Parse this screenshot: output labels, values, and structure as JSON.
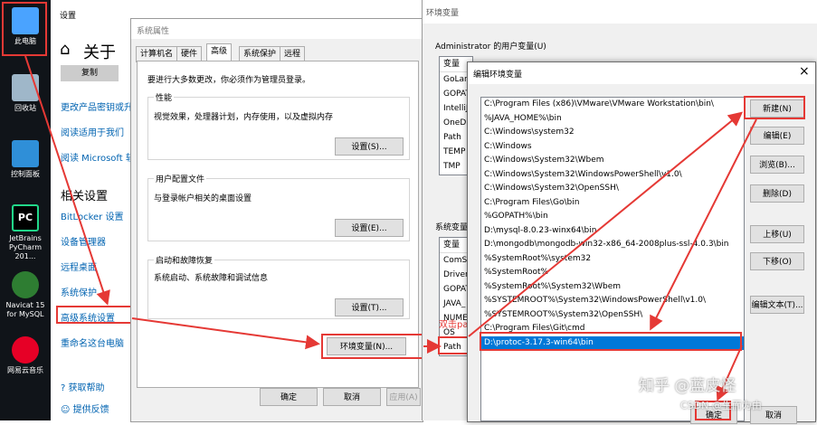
{
  "desktop": {
    "icons": [
      {
        "label": "此电脑",
        "icon": "this-pc-icon",
        "color": "#4aa3ff"
      },
      {
        "label": "回收站",
        "icon": "recycle-bin-icon",
        "color": "#9fb7c9"
      },
      {
        "label": "控制面板",
        "icon": "control-panel-icon",
        "color": "#2f8fd8"
      },
      {
        "label": "JetBrains PyCharm 201...",
        "icon": "pycharm-icon",
        "color": "#21d789"
      },
      {
        "label": "Navicat 15 for MySQL",
        "icon": "navicat-icon",
        "color": "#2e7d32"
      },
      {
        "label": "网易云音乐",
        "icon": "netease-music-icon",
        "color": "#e60026"
      }
    ]
  },
  "settings": {
    "title": "设置",
    "heading": "关于",
    "copy_button": "复制",
    "links_top": [
      "更改产品密钥或升",
      "阅读适用于我们",
      "阅读 Microsoft 软"
    ],
    "related_heading": "相关设置",
    "related_links": [
      "BitLocker 设置",
      "设备管理器",
      "远程桌面",
      "系统保护",
      "高级系统设置",
      "重命名这台电脑"
    ],
    "help": "获取帮助",
    "feedback": "提供反馈"
  },
  "sysprops": {
    "title": "系统属性",
    "tabs": [
      "计算机名",
      "硬件",
      "高级",
      "系统保护",
      "远程"
    ],
    "admin_note": "要进行大多数更改，你必须作为管理员登录。",
    "performance": {
      "title": "性能",
      "desc": "视觉效果，处理器计划，内存使用，以及虚拟内存",
      "button": "设置(S)..."
    },
    "profile": {
      "title": "用户配置文件",
      "desc": "与登录帐户相关的桌面设置",
      "button": "设置(E)..."
    },
    "startup": {
      "title": "启动和故障恢复",
      "desc": "系统启动、系统故障和调试信息",
      "button": "设置(T)..."
    },
    "env_button": "环境变量(N)...",
    "ok": "确定",
    "cancel": "取消",
    "apply": "应用(A)"
  },
  "envvars": {
    "title": "环境变量",
    "user_section": "Administrator 的用户变量(U)",
    "col_var": "变量",
    "user_vars": [
      "GoLan",
      "GOPAT",
      "IntelliJ",
      "OneDr",
      "Path",
      "TEMP",
      "TMP"
    ],
    "system_section": "系统变量",
    "system_vars": [
      "ComSp",
      "Driver",
      "GOPAT",
      "JAVA_",
      "NUME",
      "OS",
      "Path"
    ],
    "annotation": "双击path"
  },
  "editenv": {
    "title": "编辑环境变量",
    "close": "×",
    "paths": [
      "C:\\Program Files (x86)\\VMware\\VMware Workstation\\bin\\",
      "%JAVA_HOME%\\bin",
      "C:\\Windows\\system32",
      "C:\\Windows",
      "C:\\Windows\\System32\\Wbem",
      "C:\\Windows\\System32\\WindowsPowerShell\\v1.0\\",
      "C:\\Windows\\System32\\OpenSSH\\",
      "C:\\Program Files\\Go\\bin",
      "%GOPATH%\\bin",
      "D:\\mysql-8.0.23-winx64\\bin",
      "D:\\mongodb\\mongodb-win32-x86_64-2008plus-ssl-4.0.3\\bin",
      "%SystemRoot%\\system32",
      "%SystemRoot%",
      "%SystemRoot%\\System32\\Wbem",
      "%SYSTEMROOT%\\System32\\WindowsPowerShell\\v1.0\\",
      "%SYSTEMROOT%\\System32\\OpenSSH\\",
      "C:\\Program Files\\Git\\cmd",
      "D:\\protoc-3.17.3-win64\\bin"
    ],
    "selected_index": 17,
    "buttons": [
      "新建(N)",
      "编辑(E)",
      "浏览(B)...",
      "删除(D)",
      "上移(U)",
      "下移(O)",
      "编辑文本(T)..."
    ],
    "ok": "确定",
    "cancel": "取消"
  },
  "watermark": {
    "zhihu": "知乎 @蓝皮怪",
    "csdn": "CSDN @生而为由"
  },
  "colors": {
    "accent": "#0078d7",
    "highlight": "#e53935",
    "link": "#0063b1"
  }
}
